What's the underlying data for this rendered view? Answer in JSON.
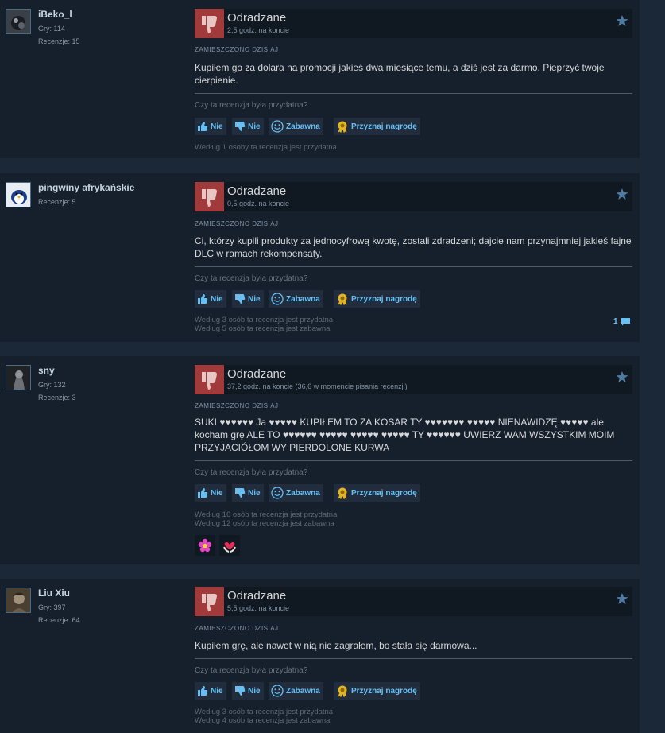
{
  "labels": {
    "verdict": "Odradzane",
    "posted": "ZAMIESZCZONO DZISIAJ",
    "question": "Czy ta recenzja była przydatna?",
    "yes": "Nie",
    "no": "Nie",
    "funny": "Zabawna",
    "award": "Przyznaj nagrodę"
  },
  "icons": {
    "thumb_down": "thumbs-down-icon",
    "star": "star-icon",
    "comment": "comment-icon",
    "funny": "smiley-icon",
    "award": "award-icon"
  },
  "colors": {
    "negative": "#a13a3a",
    "accent": "#66c0f4"
  },
  "reviews": [
    {
      "author": "iBeko_l",
      "games": "Gry: 114",
      "reviews": "Recenzje: 15",
      "hours": "2,5 godz. na koncie",
      "text": "Kupiłem go za dolara na promocji jakieś dwa miesiące temu, a dziś jest za darmo. Pieprzyć twoje cierpienie.",
      "helpful": "Według 1 osoby ta recenzja jest przydatna"
    },
    {
      "author": "pingwiny afrykańskie",
      "reviews": "Recenzje: 5",
      "hours": "0,5 godz. na koncie",
      "text": "Ci, którzy kupili produkty za jednocyfrową kwotę, zostali zdradzeni; dajcie nam przynajmniej jakieś fajne DLC w ramach rekompensaty.",
      "helpful": "Według 3 osób ta recenzja jest przydatna",
      "funny_count": "Według 5 osób ta recenzja jest zabawna",
      "comments": "1"
    },
    {
      "author": "sny",
      "games": "Gry: 132",
      "reviews": "Recenzje: 3",
      "hours": "37,2 godz. na koncie (36,6 w momencie pisania recenzji)",
      "text": "SUKI ♥♥♥♥♥♥ Ja ♥♥♥♥♥ KUPIŁEM TO ZA KOSAR TY ♥♥♥♥♥♥♥ ♥♥♥♥♥ NIENAWIDZĘ ♥♥♥♥♥ ale kocham grę ALE TO ♥♥♥♥♥♥ ♥♥♥♥♥ ♥♥♥♥♥ ♥♥♥♥♥ TY ♥♥♥♥♥♥ UWIERZ WAM WSZYSTKIM MOIM PRZYJACIÓŁOM WY PIERDOLONE KURWA",
      "helpful": "Według 16 osób ta recenzja jest przydatna",
      "funny_count": "Według 12 osób ta recenzja jest zabawna",
      "awards": [
        "flower-award-icon",
        "heart-hands-award-icon"
      ]
    },
    {
      "author": "Liu Xiu",
      "games": "Gry: 397",
      "reviews": "Recenzje: 64",
      "hours": "5,5 godz. na koncie",
      "text": "Kupiłem grę, ale nawet w nią nie zagrałem, bo stała się darmowa...",
      "helpful": "Według 3 osób ta recenzja jest przydatna",
      "funny_count": "Według 4 osób ta recenzja jest zabawna"
    }
  ]
}
